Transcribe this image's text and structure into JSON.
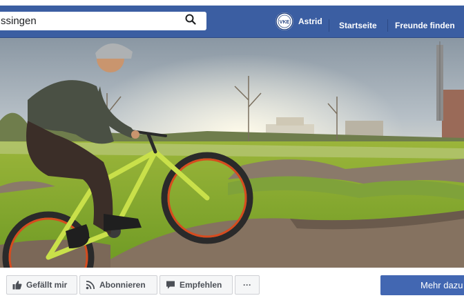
{
  "search": {
    "value": "ssingen",
    "placeholder": ""
  },
  "profile": {
    "name": "Astrid",
    "avatar_text": "VKE"
  },
  "nav": {
    "home": "Startseite",
    "find_friends": "Freunde finden"
  },
  "actions": {
    "like": "Gefällt mir",
    "follow": "Abonnieren",
    "recommend": "Empfehlen",
    "more": "···",
    "primary": "Mehr dazu"
  },
  "colors": {
    "navbar": "#3b5ea2",
    "primary_button": "#4267b2",
    "button_background": "#f5f6f7",
    "button_border": "#ced0d4"
  },
  "icons": [
    "search-icon",
    "thumbs-up-icon",
    "rss-icon",
    "speech-bubble-icon",
    "more-icon"
  ]
}
